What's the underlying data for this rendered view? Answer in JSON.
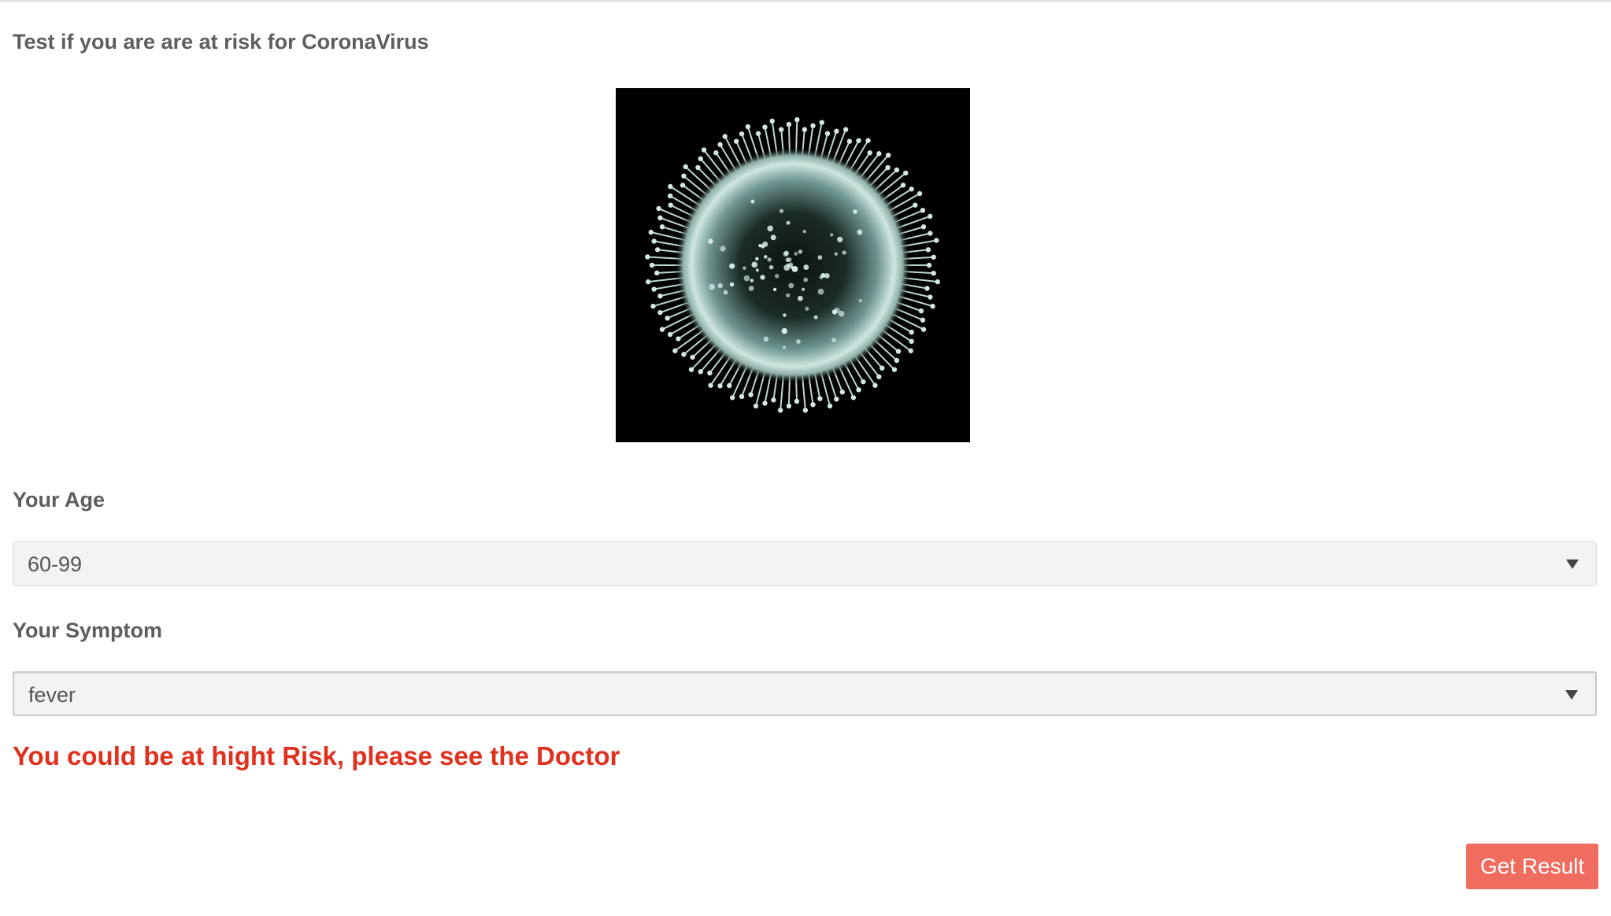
{
  "page": {
    "title": "Test if you are are at risk for CoronaVirus"
  },
  "image": {
    "alt": "coronavirus-illustration"
  },
  "age_field": {
    "label": "Your Age",
    "selected": "60-99"
  },
  "symptom_field": {
    "label": "Your Symptom",
    "selected": "fever"
  },
  "result": {
    "message": "You could be at hight Risk, please see the Doctor"
  },
  "actions": {
    "get_result_label": "Get Result"
  },
  "colors": {
    "text": "#5d5d5d",
    "alert": "#e0301e",
    "button": "#ef6c5f",
    "select_bg": "#f3f3f3"
  }
}
